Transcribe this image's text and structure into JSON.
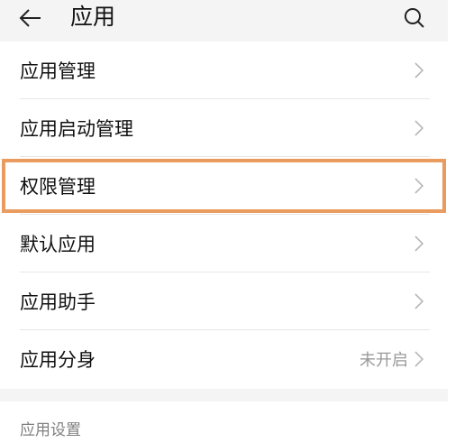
{
  "header": {
    "title": "应用",
    "back_icon": "arrow-left-icon",
    "search_icon": "search-icon"
  },
  "list": {
    "items": [
      {
        "label": "应用管理",
        "value": ""
      },
      {
        "label": "应用启动管理",
        "value": ""
      },
      {
        "label": "权限管理",
        "value": ""
      },
      {
        "label": "默认应用",
        "value": ""
      },
      {
        "label": "应用助手",
        "value": ""
      },
      {
        "label": "应用分身",
        "value": "未开启"
      }
    ]
  },
  "section": {
    "title": "应用设置"
  },
  "colors": {
    "highlight": "#ea9c60",
    "header_bg": "#f4f4f4"
  }
}
